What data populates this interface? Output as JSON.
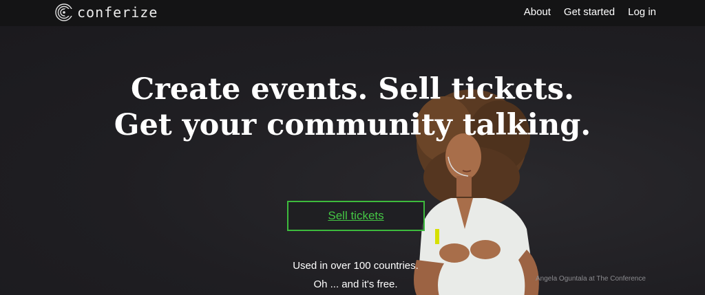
{
  "brand": {
    "name": "conferize",
    "logo_icon": "conferize-logo-icon"
  },
  "nav": {
    "items": [
      "About",
      "Get started",
      "Log in"
    ]
  },
  "hero": {
    "headline_line1": "Create events. Sell tickets.",
    "headline_line2": "Get your community talking.",
    "cta_label": "Sell tickets",
    "tagline_line1": "Used in over 100 countries.",
    "tagline_line2": "Oh ... and it's free.",
    "photo_credit": "Angela Oguntala at The Conference"
  },
  "colors": {
    "background": "#1f1e22",
    "topbar": "#141415",
    "accent": "#3dbb3d",
    "text": "#ffffff"
  }
}
